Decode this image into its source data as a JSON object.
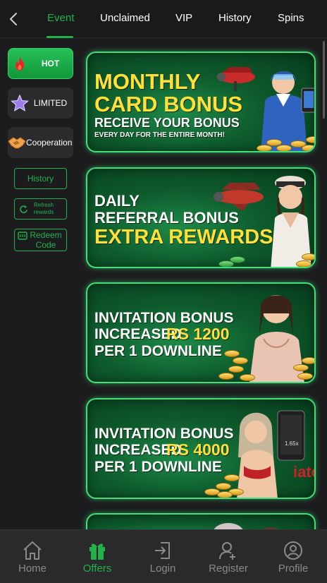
{
  "header": {
    "tabs": [
      {
        "label": "Event",
        "active": true
      },
      {
        "label": "Unclaimed",
        "active": false
      },
      {
        "label": "VIP",
        "active": false
      },
      {
        "label": "History",
        "active": false
      },
      {
        "label": "Spins",
        "active": false
      }
    ],
    "back_icon": "chevron-left-icon"
  },
  "sidebar": {
    "categories": [
      {
        "label": "HOT",
        "icon": "flame-icon",
        "active": true
      },
      {
        "label": "LIMITED",
        "icon": "star-icon",
        "active": false
      },
      {
        "label": "Cooperation",
        "icon": "handshake-icon",
        "active": false
      }
    ],
    "history_label": "History",
    "refresh_label": "Refresh rewards",
    "redeem_label": "Redeem Code"
  },
  "banners": [
    {
      "lines": [
        "MONTHLY",
        "CARD BONUS",
        "RECEIVE YOUR BONUS",
        "EVERY DAY FOR THE ENTIRE MONTH!"
      ]
    },
    {
      "lines": [
        "DAILY",
        "REFERRAL BONUS",
        "EXTRA REWARDS"
      ]
    },
    {
      "lines": [
        "INVITATION BONUS",
        "INCREASED",
        "RS 1200",
        "PER 1 DOWNLINE"
      ]
    },
    {
      "lines": [
        "INVITATION BONUS",
        "INCREASED",
        "RS 4000",
        "PER 1 DOWNLINE"
      ],
      "phone_text": "1.65x"
    }
  ],
  "bottom_nav": [
    {
      "label": "Home",
      "icon": "home-icon",
      "active": false
    },
    {
      "label": "Offers",
      "icon": "gift-icon",
      "active": true
    },
    {
      "label": "Login",
      "icon": "login-icon",
      "active": false
    },
    {
      "label": "Register",
      "icon": "add-user-icon",
      "active": false
    },
    {
      "label": "Profile",
      "icon": "profile-icon",
      "active": false
    }
  ],
  "colors": {
    "accent": "#21b24b",
    "banner_yellow": "#ffe03a",
    "background": "#1c1c1e"
  }
}
